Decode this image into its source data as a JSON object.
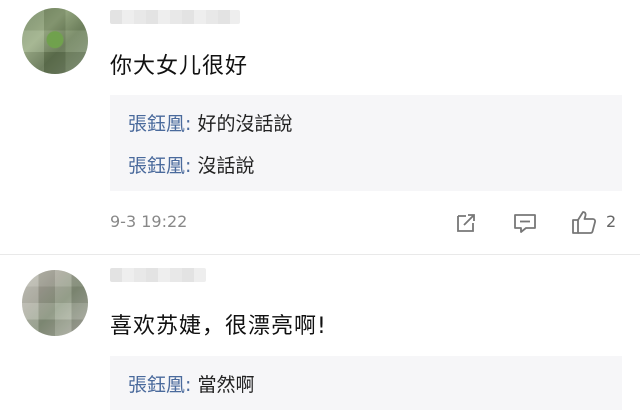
{
  "comments": [
    {
      "text": "你大女儿很好",
      "replies": [
        {
          "author": "張鈺凰",
          "text": "好的沒話說"
        },
        {
          "author": "張鈺凰",
          "text": "沒話說"
        }
      ],
      "timestamp": "9-3 19:22",
      "like_count": "2"
    },
    {
      "text": "喜欢苏婕，很漂亮啊!",
      "replies": [
        {
          "author": "張鈺凰",
          "text": "當然啊"
        }
      ]
    }
  ],
  "separator": ": ",
  "icons": {
    "share": "share-icon",
    "comment": "comment-icon",
    "like": "thumbs-up-icon"
  },
  "colors": {
    "reply_author": "#4a6a9c",
    "reply_bg": "#f6f6f8"
  }
}
